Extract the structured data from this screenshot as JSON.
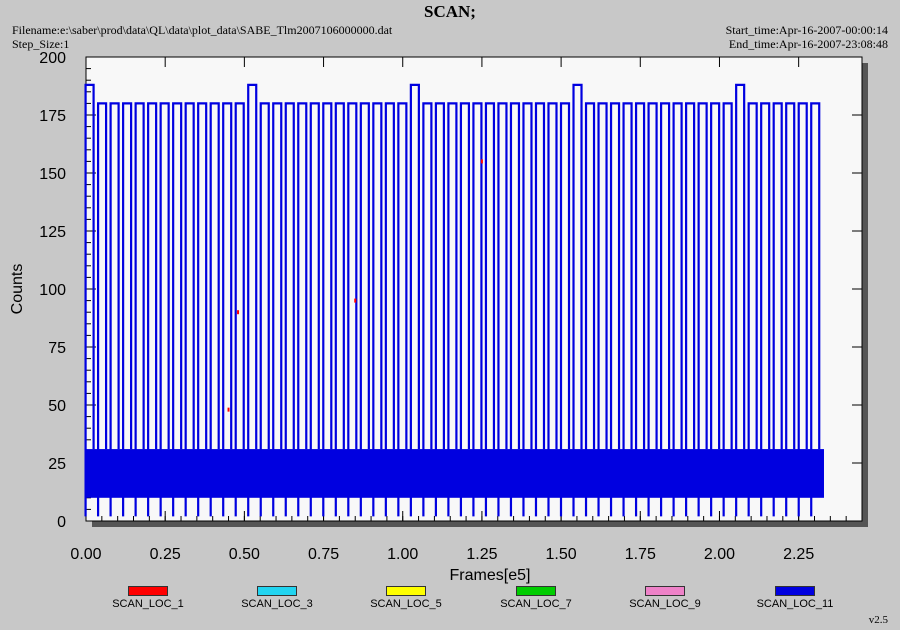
{
  "header": {
    "title": "SCAN;",
    "filename": "Filename:e:\\saber\\prod\\data\\QL\\data\\plot_data\\SABE_Tlm2007106000000.dat",
    "step_size": "Step_Size:1",
    "start_time": "Start_time:Apr-16-2007-00:00:14",
    "end_time": "End_time:Apr-16-2007-23:08:48"
  },
  "version": "v2.5",
  "colors": {
    "plot_bg": "#f8f8f8",
    "page_bg": "#c8c8c8",
    "shadow": "#555555"
  },
  "chart_data": {
    "type": "line",
    "xlabel": "Frames[e5]",
    "ylabel": "Counts",
    "xlim": [
      0,
      2.45
    ],
    "ylim": [
      0,
      200
    ],
    "xticks": [
      "0.00",
      "0.25",
      "0.50",
      "0.75",
      "1.00",
      "1.25",
      "1.50",
      "1.75",
      "2.00",
      "2.25"
    ],
    "yticks": [
      "0",
      "25",
      "50",
      "75",
      "100",
      "125",
      "150",
      "175",
      "200"
    ],
    "grid": false,
    "legend_position": "bottom",
    "series": [
      {
        "name": "SCAN_LOC_1",
        "color": "#ff0000",
        "x": [
          0.45,
          0.48,
          0.85,
          1.25
        ],
        "y": [
          48,
          90,
          95,
          155
        ]
      },
      {
        "name": "SCAN_LOC_3",
        "color": "#22d4f0",
        "x": [],
        "y": []
      },
      {
        "name": "SCAN_LOC_5",
        "color": "#ffff00",
        "x": [],
        "y": []
      },
      {
        "name": "SCAN_LOC_7",
        "color": "#00cc00",
        "x": [],
        "y": []
      },
      {
        "name": "SCAN_LOC_9",
        "color": "#ee82c8",
        "x": [],
        "y": []
      },
      {
        "name": "SCAN_LOC_11",
        "color": "#0000e0",
        "pattern": "periodic scan",
        "x_start": 0.0,
        "x_end": 2.33,
        "period": 0.0395,
        "scan_peak": 180,
        "scan_peak_alt": 188,
        "band_low": 10,
        "band_high": 31,
        "dip_low": 2
      }
    ]
  }
}
